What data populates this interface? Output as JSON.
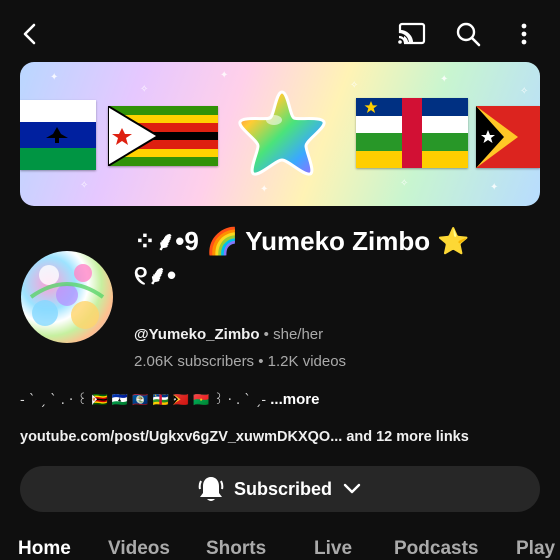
{
  "topbar": {
    "back_icon": "chevron-left-icon",
    "cast_icon": "cast-icon",
    "search_icon": "search-icon",
    "more_icon": "more-vertical-icon"
  },
  "banner": {
    "flags": [
      "Lesotho",
      "Zimbabwe",
      "Central African Republic",
      "East Timor"
    ],
    "center_icon": "rainbow-star-icon"
  },
  "channel": {
    "title_prefix": "⁘⸙•9 🌈",
    "title_name": "Yumeko Zimbo",
    "title_suffix": "⭐",
    "title_line2": "୧⸙•",
    "handle": "@Yumeko_Zimbo",
    "separator": "•",
    "pronouns": "she/her",
    "subscribers": "2.06K subscribers",
    "videos": "1.2K videos",
    "description": "- ˋ ˏ  ˋ . · ꒰ 🇿🇼 🇱🇸 🇧🇿 🇨🇫 🇹🇱 🇧🇫 ꒱ · . ˋ  ˏ-",
    "more_label": "...more",
    "link": "youtube.com/post/Ugkxv6gZV_xuwmDKXQO...",
    "more_links": "and 12 more links"
  },
  "subscribe": {
    "label": "Subscribed",
    "bell_icon": "bell-icon",
    "dropdown_icon": "chevron-down-icon"
  },
  "tabs": [
    {
      "label": "Home",
      "active": true
    },
    {
      "label": "Videos",
      "active": false
    },
    {
      "label": "Shorts",
      "active": false
    },
    {
      "label": "Live",
      "active": false
    },
    {
      "label": "Podcasts",
      "active": false
    },
    {
      "label": "Play",
      "active": false
    }
  ],
  "colors": {
    "background": "#0f0f0f",
    "button_bg": "#272727",
    "muted_text": "#aaaaaa"
  }
}
